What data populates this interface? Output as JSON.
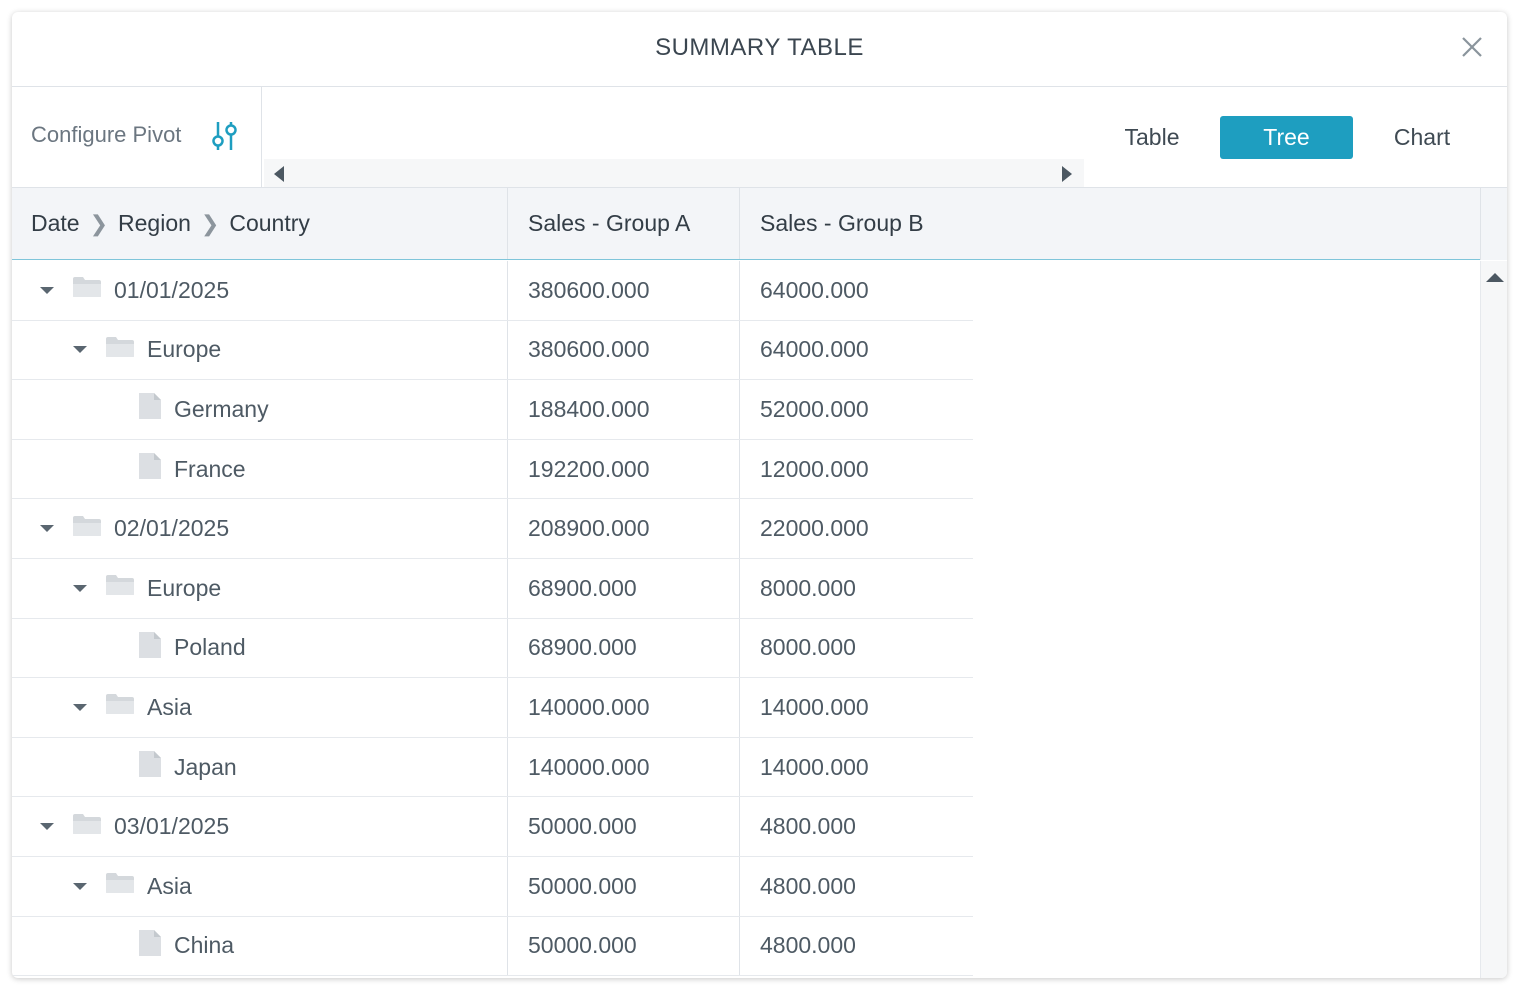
{
  "dialog": {
    "title": "SUMMARY TABLE"
  },
  "toolbar": {
    "configure_label": "Configure Pivot",
    "views": [
      "Table",
      "Tree",
      "Chart"
    ],
    "active_view": "Tree"
  },
  "columns": {
    "path": [
      "Date",
      "Region",
      "Country"
    ],
    "group_a": "Sales - Group A",
    "group_b": "Sales - Group B"
  },
  "rows": [
    {
      "level": 0,
      "type": "folder",
      "expanded": true,
      "label": "01/01/2025",
      "a": "380600.000",
      "b": "64000.000"
    },
    {
      "level": 1,
      "type": "folder",
      "expanded": true,
      "label": "Europe",
      "a": "380600.000",
      "b": "64000.000"
    },
    {
      "level": 2,
      "type": "file",
      "label": "Germany",
      "a": "188400.000",
      "b": "52000.000"
    },
    {
      "level": 2,
      "type": "file",
      "label": "France",
      "a": "192200.000",
      "b": "12000.000"
    },
    {
      "level": 0,
      "type": "folder",
      "expanded": true,
      "label": "02/01/2025",
      "a": "208900.000",
      "b": "22000.000"
    },
    {
      "level": 1,
      "type": "folder",
      "expanded": true,
      "label": "Europe",
      "a": "68900.000",
      "b": "8000.000"
    },
    {
      "level": 2,
      "type": "file",
      "label": "Poland",
      "a": "68900.000",
      "b": "8000.000"
    },
    {
      "level": 1,
      "type": "folder",
      "expanded": true,
      "label": "Asia",
      "a": "140000.000",
      "b": "14000.000"
    },
    {
      "level": 2,
      "type": "file",
      "label": "Japan",
      "a": "140000.000",
      "b": "14000.000"
    },
    {
      "level": 0,
      "type": "folder",
      "expanded": true,
      "label": "03/01/2025",
      "a": "50000.000",
      "b": "4800.000"
    },
    {
      "level": 1,
      "type": "folder",
      "expanded": true,
      "label": "Asia",
      "a": "50000.000",
      "b": "4800.000"
    },
    {
      "level": 2,
      "type": "file",
      "label": "China",
      "a": "50000.000",
      "b": "4800.000"
    }
  ],
  "colors": {
    "accent": "#1e9ec0",
    "text": "#4e5a64",
    "icon_gray": "#d4d8dc"
  },
  "icons": {
    "close": "close-icon",
    "configure": "sliders-icon",
    "folder": "folder-icon",
    "file": "file-icon",
    "expand": "caret-down-icon"
  }
}
